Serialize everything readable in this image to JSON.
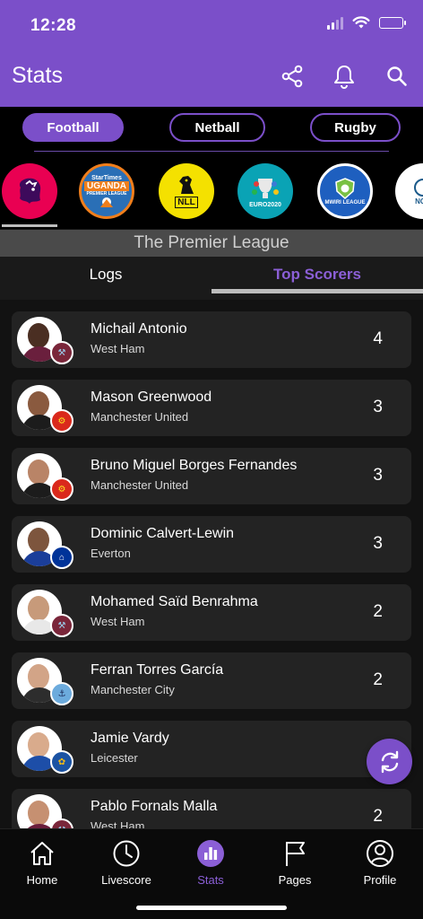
{
  "status_bar": {
    "time": "12:28"
  },
  "header": {
    "title": "Stats"
  },
  "sports_tabs": [
    {
      "label": "Football",
      "active": true
    },
    {
      "label": "Netball",
      "active": false
    },
    {
      "label": "Rugby",
      "active": false
    }
  ],
  "leagues": [
    {
      "icon": "premier-league-lion-icon",
      "text": "",
      "selected": true
    },
    {
      "icon": "uganda-premier-league-icon",
      "text": "UGANDA",
      "sub": "PREMIER LEAGUE",
      "top": "StarTimes"
    },
    {
      "icon": "nll-lion-icon",
      "text": "NLL"
    },
    {
      "icon": "euro-2020-icon",
      "text": "EURO2020"
    },
    {
      "icon": "mwiri-league-icon",
      "text": "MWIRI LEAGUE"
    },
    {
      "icon": "nga-football-icon",
      "text": "NGA"
    }
  ],
  "league_name": "The Premier League",
  "view_tabs": {
    "logs": "Logs",
    "top_scorers": "Top Scorers",
    "active": "top_scorers"
  },
  "scorers": [
    {
      "name": "Michail Antonio",
      "team": "West Ham",
      "goals": "4"
    },
    {
      "name": "Mason Greenwood",
      "team": "Manchester United",
      "goals": "3"
    },
    {
      "name": "Bruno Miguel Borges Fernandes",
      "team": "Manchester United",
      "goals": "3"
    },
    {
      "name": "Dominic Calvert-Lewin",
      "team": "Everton",
      "goals": "3"
    },
    {
      "name": "Mohamed Saïd Benrahma",
      "team": "West Ham",
      "goals": "2"
    },
    {
      "name": "Ferran Torres García",
      "team": "Manchester City",
      "goals": "2"
    },
    {
      "name": "Jamie Vardy",
      "team": "Leicester",
      "goals": ""
    },
    {
      "name": "Pablo Fornals Malla",
      "team": "West Ham",
      "goals": "2"
    }
  ],
  "bottom_nav": [
    {
      "label": "Home",
      "icon": "home-icon"
    },
    {
      "label": "Livescore",
      "icon": "clock-icon"
    },
    {
      "label": "Stats",
      "icon": "stats-chart-icon",
      "active": true
    },
    {
      "label": "Pages",
      "icon": "flag-icon"
    },
    {
      "label": "Profile",
      "icon": "profile-icon"
    }
  ],
  "colors": {
    "accent": "#7b4fc9",
    "background": "#121212",
    "card": "#232323"
  }
}
